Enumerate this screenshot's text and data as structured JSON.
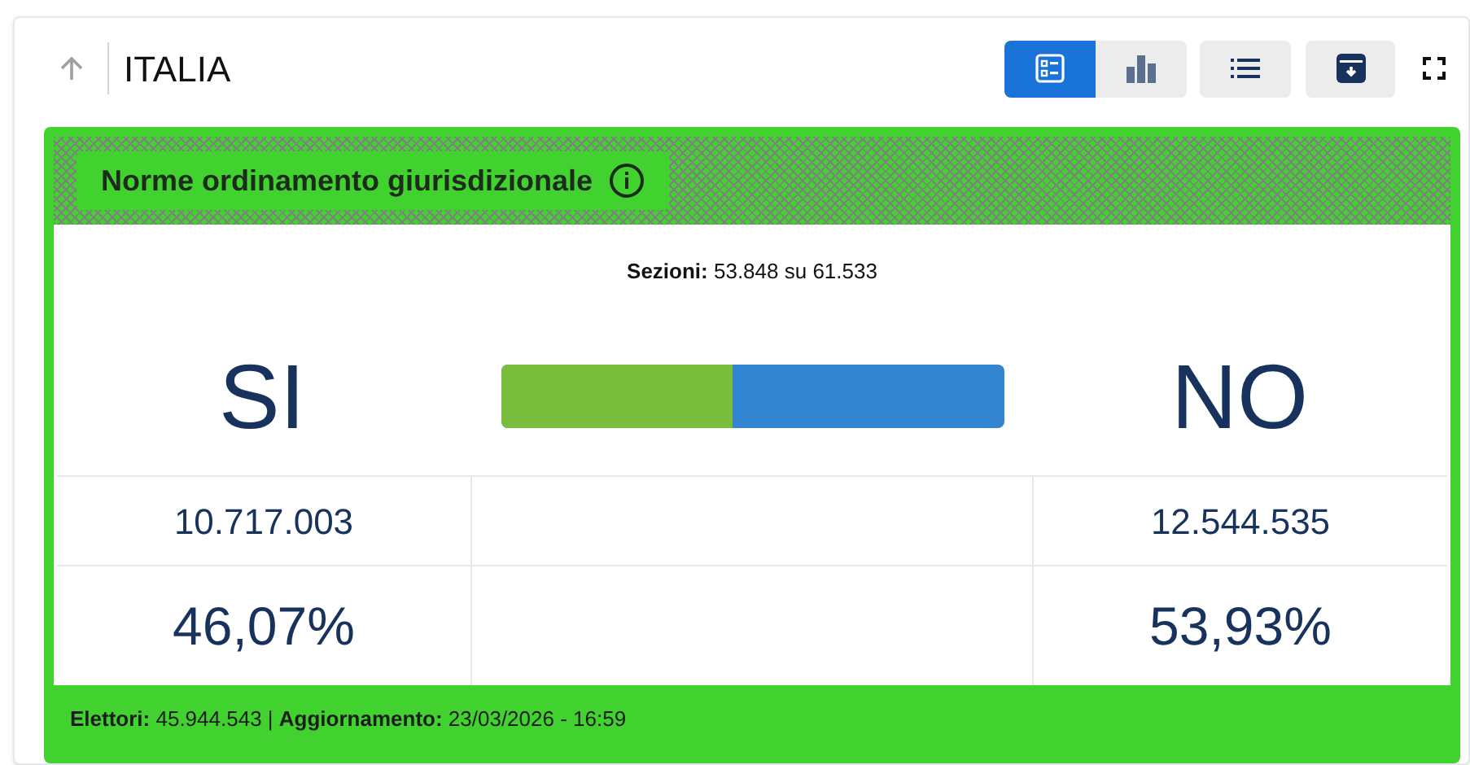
{
  "header": {
    "title": "ITALIA"
  },
  "views": [
    {
      "kind": "summary",
      "selected": true
    },
    {
      "kind": "chart",
      "selected": false
    }
  ],
  "referendum": {
    "title": "Norme ordinamento giurisdizionale",
    "sections": "**Sezioni:** 53.848 su 61.533",
    "yes": {
      "label": "SI",
      "votes": "10.717.003",
      "percent": "46,07%"
    },
    "no": {
      "label": "NO",
      "votes": "12.544.535",
      "percent": "53,93%"
    },
    "bar": {
      "level": 0.4607
    },
    "footer": "**Elettori:** 45.944.543 | **Aggiornamento:** 23/03/2026 - 16:59"
  }
}
